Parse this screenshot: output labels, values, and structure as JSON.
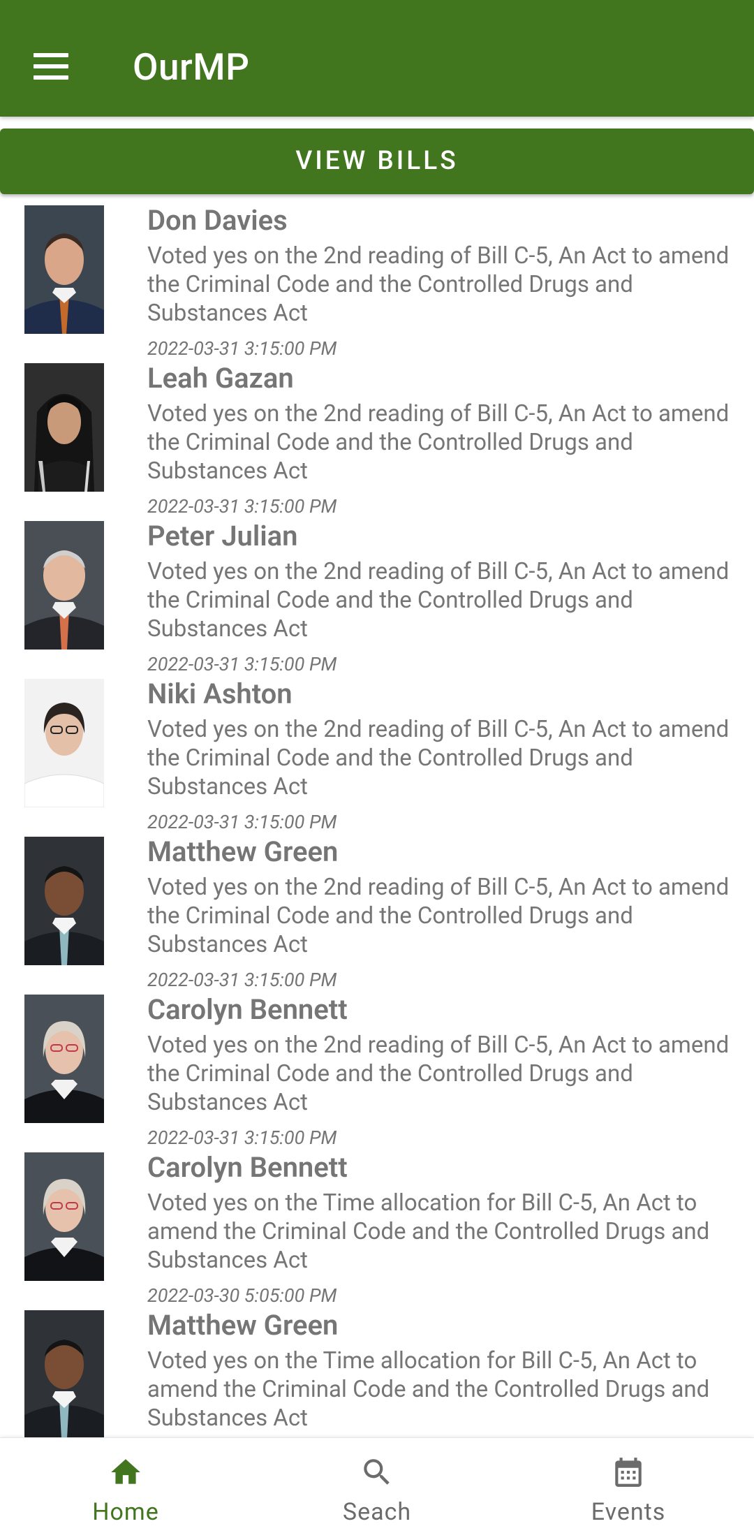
{
  "app": {
    "title": "OurMP",
    "menu_icon": "menu-icon",
    "theme_color": "#41761f",
    "text_color": "#757575"
  },
  "actions": {
    "view_bills_label": "VIEW BILLS"
  },
  "feed": [
    {
      "name": "Don Davies",
      "description": "Voted yes on the 2nd reading of Bill C-5, An Act to amend the Criminal Code and the Controlled Drugs and Substances Act",
      "date": "2022-03-31 3:15:00 PM"
    },
    {
      "name": "Leah Gazan",
      "description": "Voted yes on the 2nd reading of Bill C-5, An Act to amend the Criminal Code and the Controlled Drugs and Substances Act",
      "date": "2022-03-31 3:15:00 PM"
    },
    {
      "name": "Peter Julian",
      "description": "Voted yes on the 2nd reading of Bill C-5, An Act to amend the Criminal Code and the Controlled Drugs and Substances Act",
      "date": "2022-03-31 3:15:00 PM"
    },
    {
      "name": "Niki Ashton",
      "description": "Voted yes on the 2nd reading of Bill C-5, An Act to amend the Criminal Code and the Controlled Drugs and Substances Act",
      "date": "2022-03-31 3:15:00 PM"
    },
    {
      "name": "Matthew Green",
      "description": "Voted yes on the 2nd reading of Bill C-5, An Act to amend the Criminal Code and the Controlled Drugs and Substances Act",
      "date": "2022-03-31 3:15:00 PM"
    },
    {
      "name": "Carolyn Bennett",
      "description": "Voted yes on the 2nd reading of Bill C-5, An Act to amend the Criminal Code and the Controlled Drugs and Substances Act",
      "date": "2022-03-31 3:15:00 PM"
    },
    {
      "name": "Carolyn Bennett",
      "description": "Voted yes on the Time allocation for Bill C-5, An Act to amend the Criminal Code and the Controlled Drugs and Substances Act",
      "date": "2022-03-30 5:05:00 PM"
    },
    {
      "name": "Matthew Green",
      "description": "Voted yes on the Time allocation for Bill C-5, An Act to amend the Criminal Code and the Controlled Drugs and Substances Act",
      "date": ""
    }
  ],
  "bottom_nav": {
    "items": [
      {
        "label": "Home",
        "icon": "home-icon",
        "active": true
      },
      {
        "label": "Seach",
        "icon": "search-icon",
        "active": false
      },
      {
        "label": "Events",
        "icon": "calendar-icon",
        "active": false
      }
    ]
  }
}
